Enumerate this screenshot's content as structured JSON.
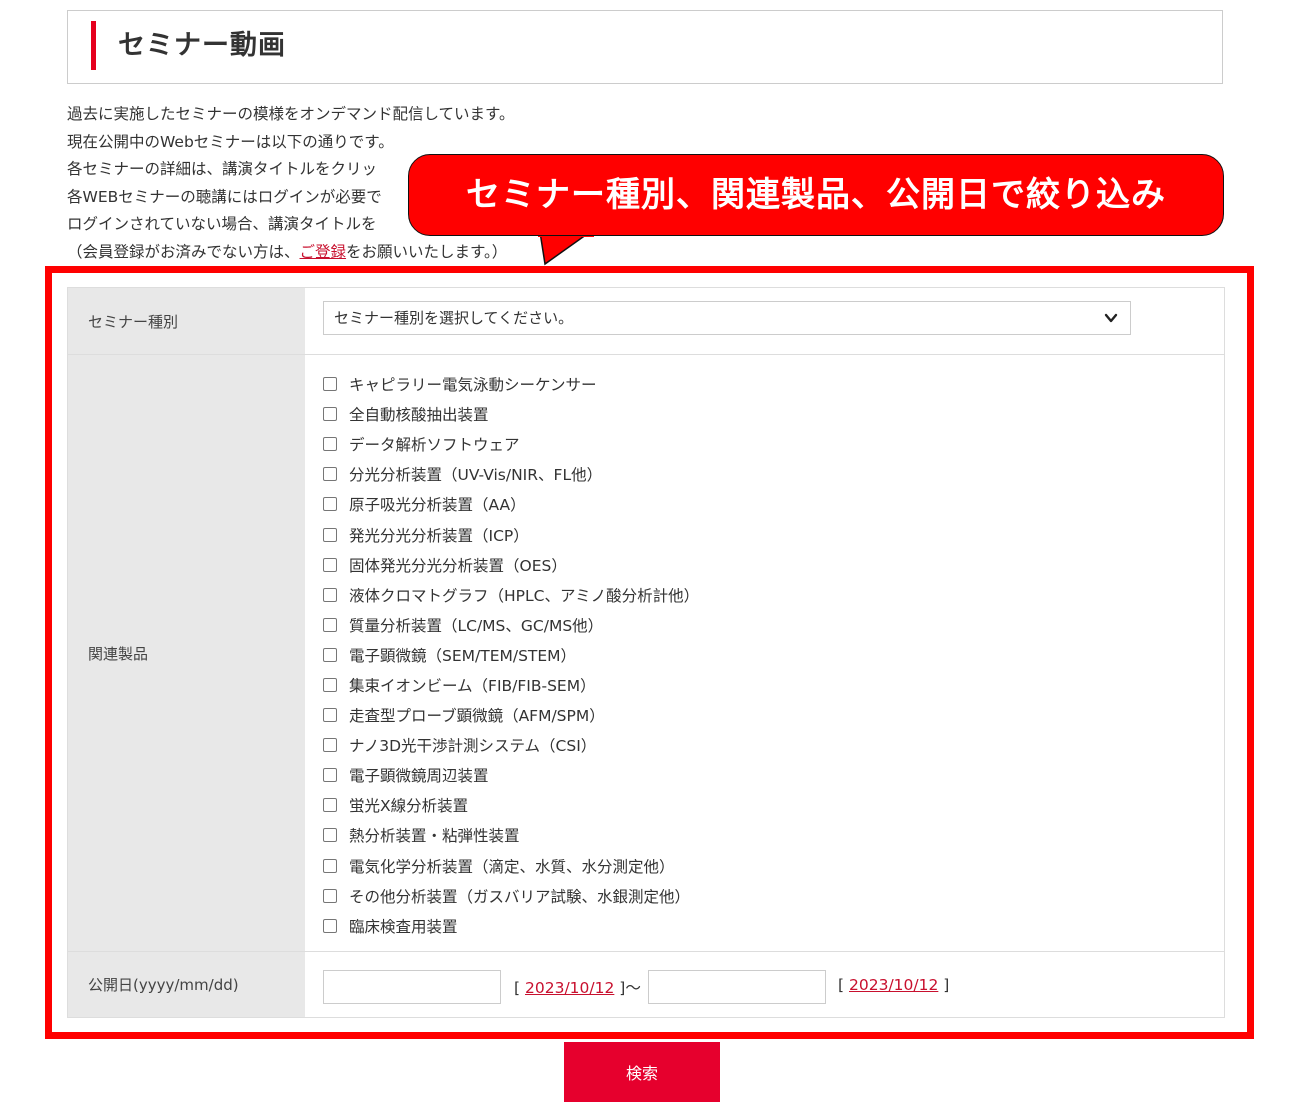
{
  "page": {
    "title": "セミナー動画"
  },
  "intro": {
    "line1": "過去に実施したセミナーの模様をオンデマンド配信しています。",
    "line2": "現在公開中のWebセミナーは以下の通りです。",
    "line3": "各セミナーの詳細は、講演タイトルをクリッ",
    "line4": "各WEBセミナーの聴講にはログインが必要で",
    "line5": "ログインされていない場合、講演タイトルを",
    "line6_prefix": "（会員登録がお済みでない方は、",
    "register_link": "ご登録",
    "line6_suffix": "をお願いいたします。）"
  },
  "callout": {
    "text": "セミナー種別、関連製品、公開日で絞り込み",
    "color": "#ff0000"
  },
  "form": {
    "seminar_type": {
      "label": "セミナー種別",
      "selected": "セミナー種別を選択してください。"
    },
    "related_products": {
      "label": "関連製品",
      "items": [
        "キャピラリー電気泳動シーケンサー",
        "全自動核酸抽出装置",
        "データ解析ソフトウェア",
        "分光分析装置（UV-Vis/NIR、FL他）",
        "原子吸光分析装置（AA）",
        "発光分光分析装置（ICP）",
        "固体発光分光分析装置（OES）",
        "液体クロマトグラフ（HPLC、アミノ酸分析計他）",
        "質量分析装置（LC/MS、GC/MS他）",
        "電子顕微鏡（SEM/TEM/STEM）",
        "集束イオンビーム（FIB/FIB-SEM）",
        "走査型プローブ顕微鏡（AFM/SPM）",
        "ナノ3D光干渉計測システム（CSI）",
        "電子顕微鏡周辺装置",
        "蛍光X線分析装置",
        "熱分析装置・粘弾性装置",
        "電気化学分析装置（滴定、水質、水分測定他）",
        "その他分析装置（ガスバリア試験、水銀測定他）",
        "臨床検査用装置"
      ]
    },
    "publish_date": {
      "label": "公開日(yyyy/mm/dd)",
      "from_value": "",
      "to_value": "",
      "bracket_open": "[",
      "from_today": "2023/10/12",
      "separator": "]〜",
      "to_today": "2023/10/12",
      "bracket_close": "]"
    }
  },
  "search_button": {
    "label": "検索",
    "color": "#e6002d"
  },
  "icons": {
    "select": "chevron-down-icon"
  }
}
